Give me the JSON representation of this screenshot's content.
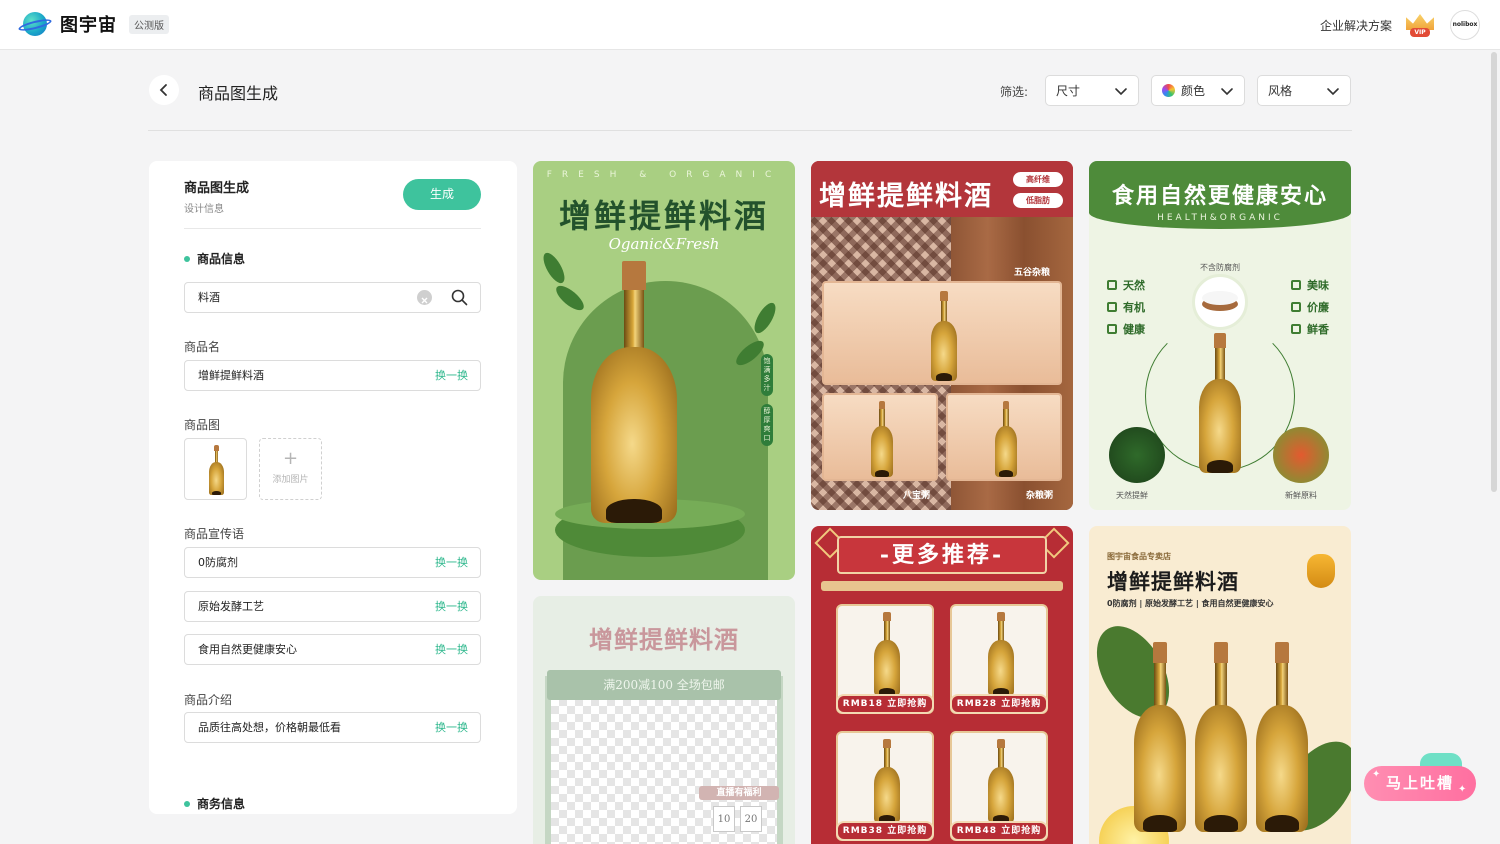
{
  "brand": {
    "name": "图宇宙",
    "beta": "公测版"
  },
  "topnav": {
    "enterprise": "企业解决方案",
    "vip": "VIP",
    "avatar": "nolibox"
  },
  "header": {
    "title": "商品图生成",
    "filter_label": "筛选:",
    "filters": [
      "尺寸",
      "颜色",
      "风格"
    ]
  },
  "panel": {
    "title": "商品图生成",
    "subtitle": "设计信息",
    "generate": "生成",
    "section_product": "商品信息",
    "search_value": "料酒",
    "name_label": "商品名",
    "name_value": "增鲜提鲜料酒",
    "swap": "换一换",
    "image_label": "商品图",
    "add_image": "添加图片",
    "slogan_label": "商品宣传语",
    "slogans": [
      "0防腐剂",
      "原始发酵工艺",
      "食用自然更健康安心"
    ],
    "intro_label": "商品介绍",
    "intro_value": "品质往高处想，价格朝最低看",
    "section_business": "商务信息"
  },
  "cards": {
    "c1": {
      "en": "FRESH & ORGANIC",
      "title": "增鲜提鲜料酒",
      "script": "Oganic&Fresh",
      "tag1": "饱满多汁",
      "tag2": "醇厚爽口"
    },
    "c2": {
      "title": "增鲜提鲜料酒",
      "pill1": "高纤维",
      "pill2": "低脂肪",
      "label_top": "五谷杂粮",
      "label_left": "八宝粥",
      "label_right": "杂粮粥"
    },
    "c3": {
      "title": "食用自然更健康安心",
      "sub": "HEALTH&ORGANIC",
      "no_pres": "不含防腐剂",
      "left": [
        "天然",
        "有机",
        "健康"
      ],
      "right": [
        "美味",
        "价廉",
        "鲜香"
      ],
      "cap_left": "天然提鲜",
      "cap_right": "新鲜原料"
    },
    "c4": {
      "title": "增鲜提鲜料酒",
      "ribbon": "满200减100 全场包邮",
      "live": "直播有福利",
      "d1": "10",
      "d2": "20"
    },
    "c5": {
      "title": "-更多推荐-",
      "prices": [
        "RMB18 立即抢购",
        "RMB28 立即抢购",
        "RMB38 立即抢购",
        "RMB48 立即抢购"
      ]
    },
    "c6": {
      "shop": "图宇宙食品专卖店",
      "title": "增鲜提鲜料酒",
      "sub": "0防腐剂 | 原始发酵工艺 | 食用自然更健康安心"
    }
  },
  "feedback": "马上吐槽",
  "colors": {
    "accent": "#3ec39d",
    "link": "#2fb88e",
    "feedback": "#ff7aa8"
  }
}
